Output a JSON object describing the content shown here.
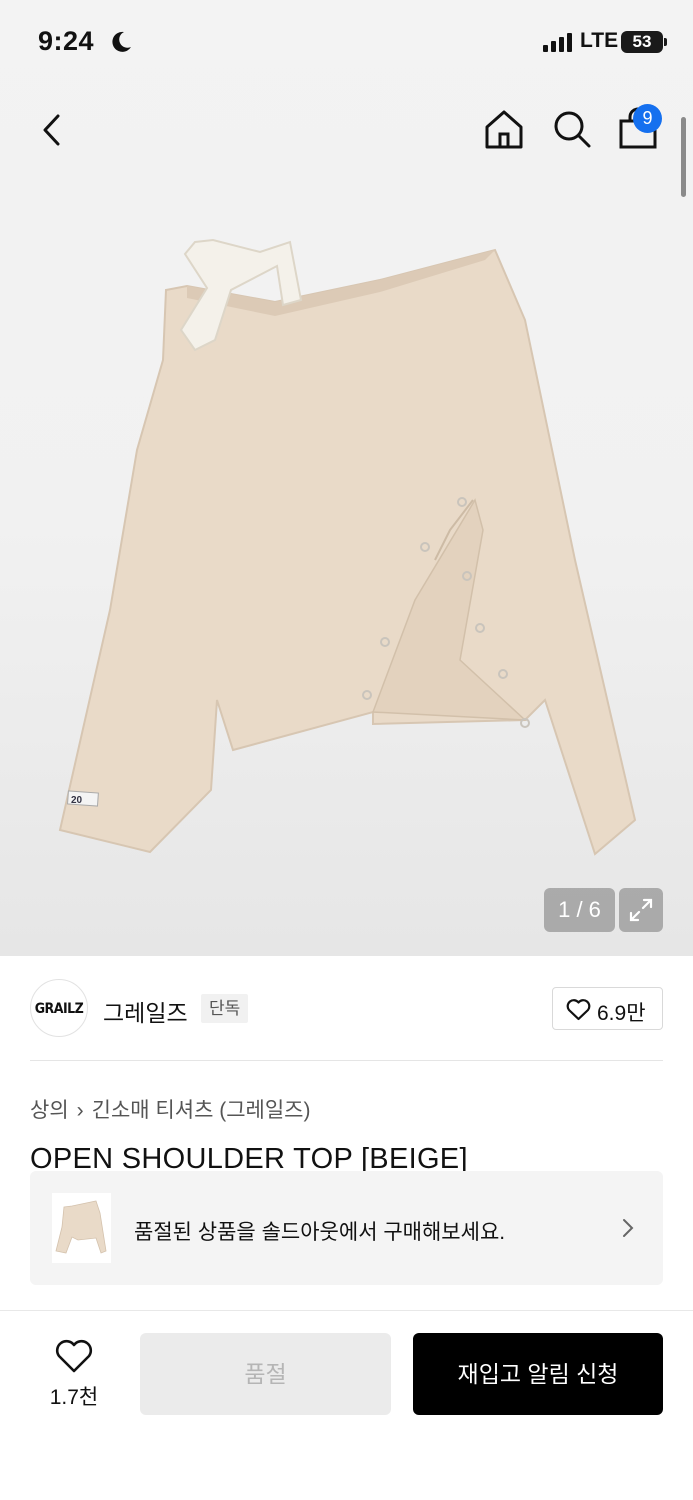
{
  "status_bar": {
    "time": "9:24",
    "network": "LTE",
    "battery": "53"
  },
  "header": {
    "cart_count": "9"
  },
  "gallery": {
    "counter": "1 / 6"
  },
  "brand": {
    "logo_text": "GRAILZ",
    "name": "그레일즈",
    "tag": "단독",
    "likes": "6.9만"
  },
  "breadcrumb": {
    "category": "상의",
    "subcategory": "긴소매 티셔츠 (그레일즈)"
  },
  "product": {
    "title": "OPEN SHOULDER TOP [BEIGE]",
    "garment_label": "20"
  },
  "soldout_banner": {
    "text": "품절된 상품을 솔드아웃에서 구매해보세요."
  },
  "bottom_bar": {
    "wish_count": "1.7천",
    "soldout_label": "품절",
    "restock_label": "재입고 알림 신청"
  },
  "colors": {
    "accent": "#1570ef",
    "garment": "#e9dac8",
    "tie": "#f4f1ea"
  },
  "icons": [
    "back-chevron-icon",
    "home-icon",
    "search-icon",
    "shopping-bag-icon",
    "expand-icon",
    "heart-icon",
    "chevron-right-icon",
    "moon-icon",
    "signal-icon"
  ]
}
